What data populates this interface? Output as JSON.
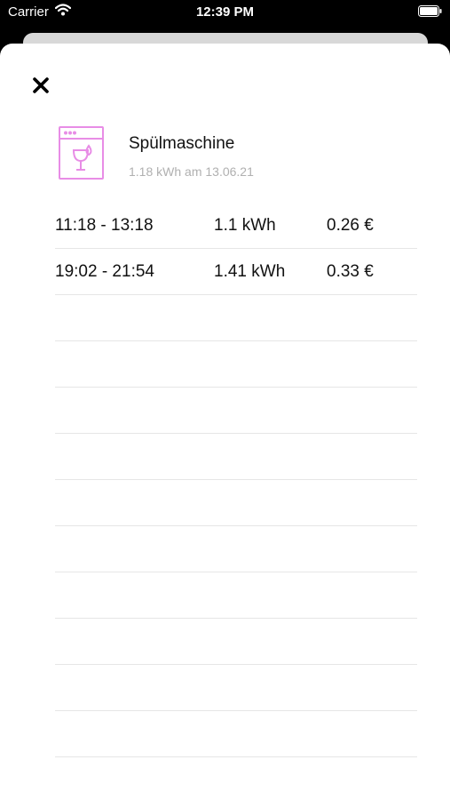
{
  "status_bar": {
    "carrier": "Carrier",
    "time": "12:39 PM"
  },
  "detail": {
    "appliance_name": "Spülmaschine",
    "subtitle": "1.18 kWh am 13.06.21",
    "accent_color": "#e88de6",
    "icon": "dishwasher-icon"
  },
  "sessions": [
    {
      "time": "11:18 - 13:18",
      "energy": "1.1 kWh",
      "cost": "0.26 €"
    },
    {
      "time": "19:02 - 21:54",
      "energy": "1.41 kWh",
      "cost": "0.33 €"
    },
    {
      "time": "",
      "energy": "",
      "cost": ""
    },
    {
      "time": "",
      "energy": "",
      "cost": ""
    },
    {
      "time": "",
      "energy": "",
      "cost": ""
    },
    {
      "time": "",
      "energy": "",
      "cost": ""
    },
    {
      "time": "",
      "energy": "",
      "cost": ""
    },
    {
      "time": "",
      "energy": "",
      "cost": ""
    },
    {
      "time": "",
      "energy": "",
      "cost": ""
    },
    {
      "time": "",
      "energy": "",
      "cost": ""
    },
    {
      "time": "",
      "energy": "",
      "cost": ""
    },
    {
      "time": "",
      "energy": "",
      "cost": ""
    }
  ]
}
